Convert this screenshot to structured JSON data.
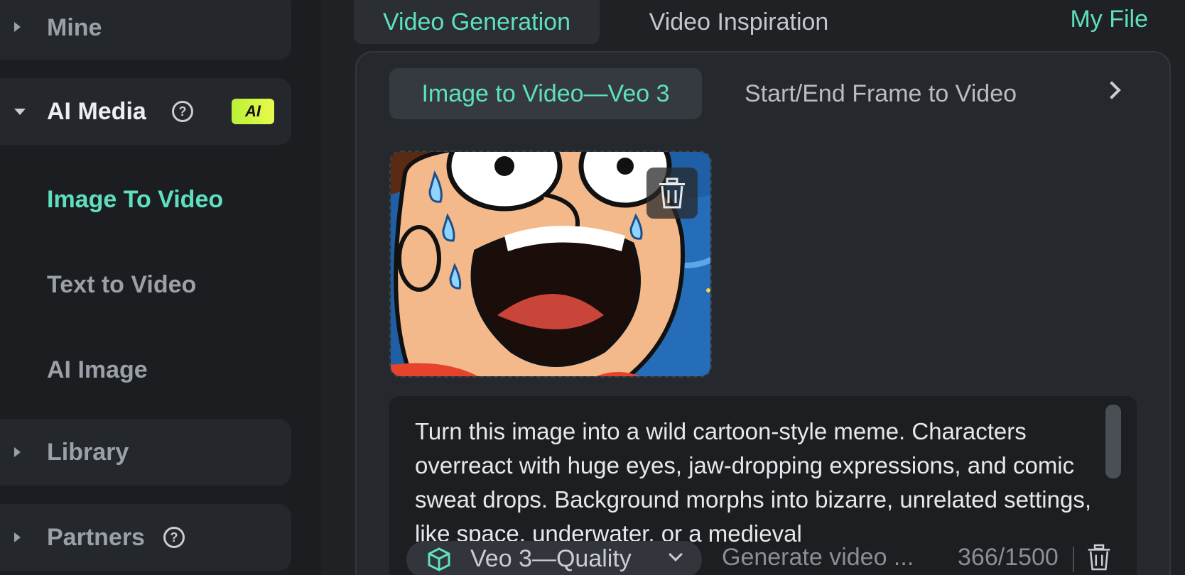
{
  "sidebar": {
    "groups": [
      {
        "label": "Mine"
      },
      {
        "label": "AI Media",
        "badge": "AI"
      },
      {
        "label": "Library"
      },
      {
        "label": "Partners"
      }
    ],
    "sub_items": [
      {
        "label": "Image To Video"
      },
      {
        "label": "Text to Video"
      },
      {
        "label": "AI Image"
      }
    ]
  },
  "top_tabs": [
    {
      "label": "Video Generation"
    },
    {
      "label": "Video Inspiration"
    }
  ],
  "my_file": "My File",
  "sub_tabs": [
    {
      "label": "Image to Video—Veo 3"
    },
    {
      "label": "Start/End Frame to Video"
    }
  ],
  "prompt": {
    "text": "Turn this image into a wild cartoon-style meme. Characters overreact with huge eyes, jaw-dropping expressions, and comic sweat drops. Background morphs into bizarre, unrelated settings, like space, underwater, or a medieval"
  },
  "bottom_bar": {
    "model": "Veo 3—Quality",
    "generate_placeholder": "Generate video ...",
    "counter": "366/1500"
  },
  "colors": {
    "accent": "#5ee0c0",
    "ai_badge": "#c8f43e"
  }
}
